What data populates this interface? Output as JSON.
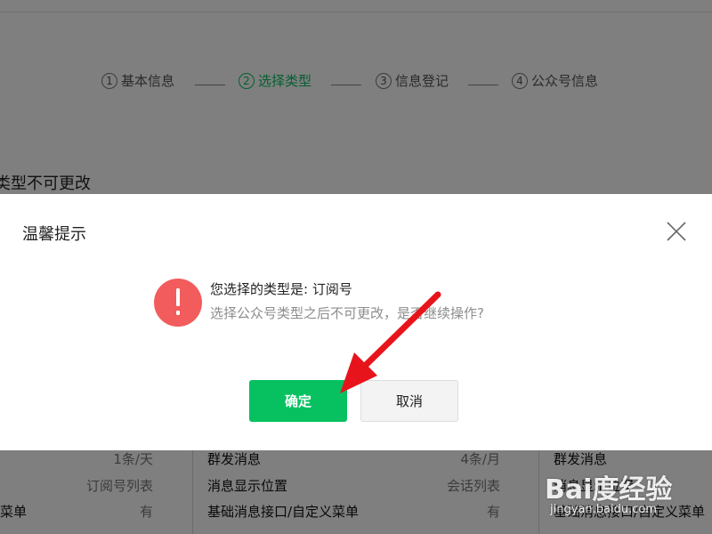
{
  "steps": [
    {
      "num": "1",
      "label": "基本信息",
      "active": false
    },
    {
      "num": "2",
      "label": "选择类型",
      "active": true
    },
    {
      "num": "3",
      "label": "信息登记",
      "active": false
    },
    {
      "num": "4",
      "label": "公众号信息",
      "active": false
    }
  ],
  "background_notice": "类型不可更改",
  "table": {
    "col1": [
      {
        "label": "",
        "value": "1条/天"
      },
      {
        "label": "",
        "value": "订阅号列表"
      },
      {
        "label": "菜单",
        "value": "有"
      }
    ],
    "col2": [
      {
        "label": "群发消息",
        "value": "4条/月"
      },
      {
        "label": "消息显示位置",
        "value": "会话列表"
      },
      {
        "label": "基础消息接口/自定义菜单",
        "value": "有"
      }
    ],
    "col3": [
      {
        "label": "群发消息",
        "value": ""
      },
      {
        "label": "消息显示位置",
        "value": ""
      },
      {
        "label": "基础消息接口/自定义菜单",
        "value": ""
      }
    ]
  },
  "dialog": {
    "title": "温馨提示",
    "message": "您选择的类型是: 订阅号",
    "submessage": "选择公众号类型之后不可更改，是否继续操作?",
    "confirm_label": "确定",
    "cancel_label": "取消"
  },
  "colors": {
    "accent": "#07c160",
    "warning": "#f25c5c",
    "annotation_arrow": "#e8141b"
  },
  "watermark": {
    "brand": "Bai度经验",
    "url": "jingyan.baidu.com"
  }
}
